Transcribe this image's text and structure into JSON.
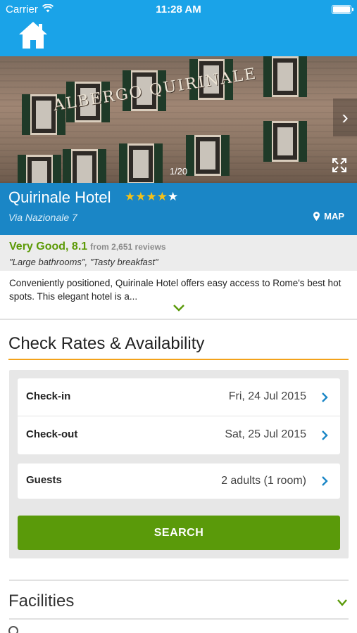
{
  "status_bar": {
    "carrier": "Carrier",
    "time": "11:28 AM"
  },
  "header": {
    "home_icon": "home-icon"
  },
  "gallery": {
    "sign_text": "ALBERGO QUIRINALE",
    "counter": "1/20",
    "next_icon": "chevron-right-icon",
    "expand_icon": "expand-icon"
  },
  "hotel": {
    "name": "Quirinale Hotel",
    "stars": 4,
    "max_stars": 5,
    "address": "Via Nazionale 7",
    "map_label": "MAP"
  },
  "review": {
    "rating_text": "Very Good, 8.1",
    "count_text": "from 2,651 reviews",
    "highlights": "\"Large bathrooms\", \"Tasty breakfast\""
  },
  "description": {
    "text": "Conveniently positioned, Quirinale Hotel offers easy access to Rome's best hot spots. This elegant hotel is a..."
  },
  "availability": {
    "title": "Check Rates & Availability",
    "checkin_label": "Check-in",
    "checkin_value": "Fri, 24 Jul 2015",
    "checkout_label": "Check-out",
    "checkout_value": "Sat, 25 Jul 2015",
    "guests_label": "Guests",
    "guests_value": "2 adults (1 room)",
    "search_label": "SEARCH"
  },
  "facilities": {
    "title": "Facilities"
  },
  "colors": {
    "header_blue": "#1aa3e8",
    "info_blue": "#1a86c6",
    "rating_green": "#5c9a06",
    "search_green": "#5a9a0a",
    "accent_orange": "#f3a21b",
    "chevron_blue": "#1a86c6"
  }
}
